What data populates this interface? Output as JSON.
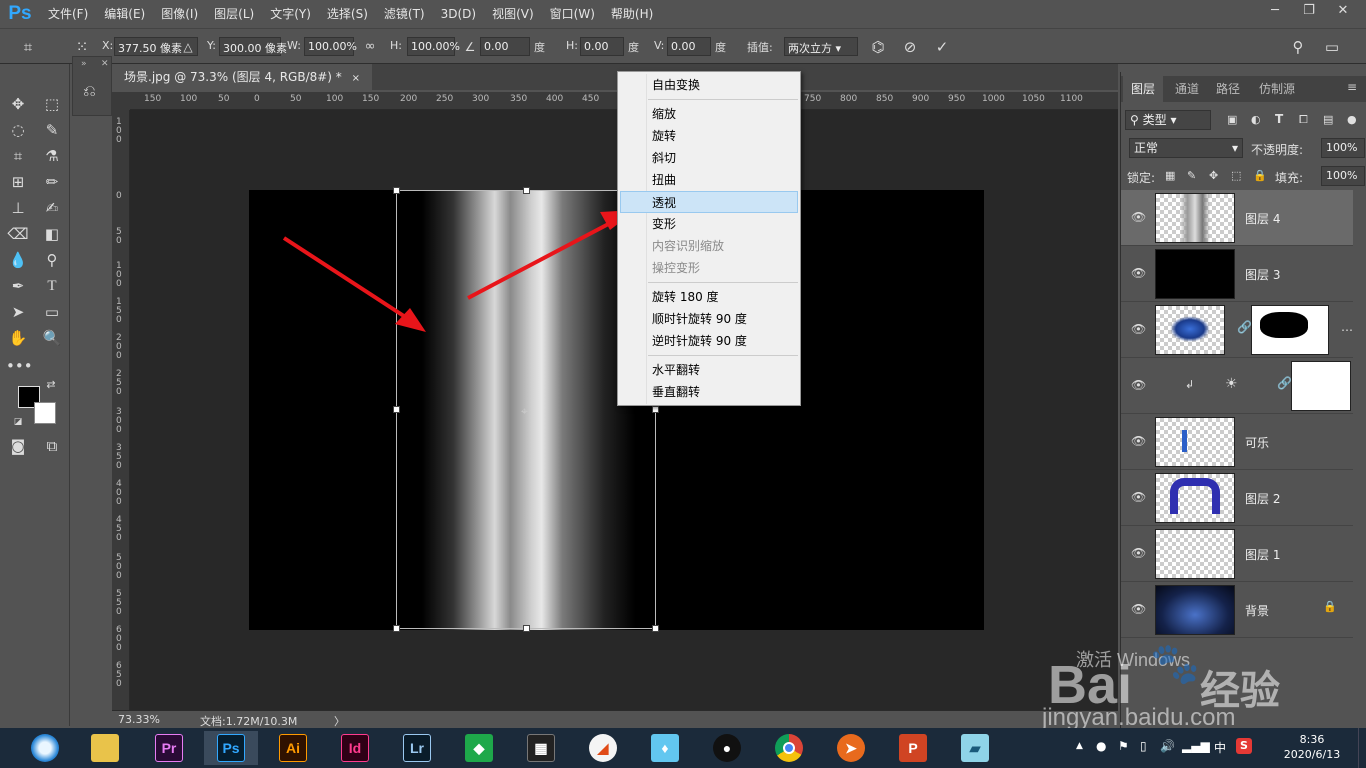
{
  "app": {
    "logo": "Ps"
  },
  "menu": [
    "文件(F)",
    "编辑(E)",
    "图像(I)",
    "图层(L)",
    "文字(Y)",
    "选择(S)",
    "滤镜(T)",
    "3D(D)",
    "视图(V)",
    "窗口(W)",
    "帮助(H)"
  ],
  "options": {
    "x_label": "X:",
    "x_value": "377.50 像素",
    "y_label": "Y:",
    "y_value": "300.00 像素",
    "w_label": "W:",
    "w_value": "100.00%",
    "h_label": "H:",
    "h_value": "100.00%",
    "angle_value": "0.00",
    "angle_unit": "度",
    "hskew_label": "H:",
    "hskew_value": "0.00",
    "hskew_unit": "度",
    "vskew_label": "V:",
    "vskew_value": "0.00",
    "vskew_unit": "度",
    "interp_label": "插值:",
    "interp_value": "两次立方"
  },
  "document": {
    "tab_title": "场景.jpg @ 73.3% (图层 4, RGB/8#) *",
    "tab_close": "×"
  },
  "ruler_h": [
    "150",
    "100",
    "50",
    "0",
    "50",
    "100",
    "150",
    "200",
    "250",
    "300",
    "350",
    "400",
    "450",
    "750",
    "800",
    "850",
    "900",
    "950",
    "1000",
    "1050",
    "1100"
  ],
  "ruler_v": [
    "100",
    "0",
    "50",
    "100",
    "150",
    "200",
    "250",
    "300",
    "350",
    "400",
    "450",
    "500",
    "550",
    "600",
    "650"
  ],
  "status": {
    "zoom": "73.33%",
    "doc": "文档:1.72M/10.3M",
    "arrow": "〉"
  },
  "context_menu": {
    "items": [
      "自由变换",
      "缩放",
      "旋转",
      "斜切",
      "扭曲",
      "透视",
      "变形",
      "内容识别缩放",
      "操控变形",
      "旋转 180 度",
      "顺时针旋转 90 度",
      "逆时针旋转 90 度",
      "水平翻转",
      "垂直翻转"
    ],
    "highlighted": "透视"
  },
  "panel": {
    "tabs": [
      "图层",
      "通道",
      "路径",
      "仿制源"
    ],
    "kind_label": "类型",
    "blend_mode": "正常",
    "opacity_label": "不透明度:",
    "opacity_value": "100%",
    "lock_label": "锁定:",
    "fill_label": "填充:",
    "fill_value": "100%",
    "layers": [
      {
        "name": "图层 4"
      },
      {
        "name": "图层 3"
      },
      {
        "name": ""
      },
      {
        "name": ""
      },
      {
        "name": "可乐"
      },
      {
        "name": "图层 2"
      },
      {
        "name": "图层 1"
      },
      {
        "name": "背景"
      }
    ]
  },
  "watermark": {
    "activate": "激活 Windows",
    "brand": "Bai",
    "brand2": "经验",
    "url": "jingyan.baidu.com"
  },
  "taskbar": {
    "apps": [
      "Pr",
      "Ps",
      "Ai",
      "Id",
      "Lr"
    ],
    "time": "8:36",
    "date": "2020/6/13",
    "ime": "中"
  }
}
